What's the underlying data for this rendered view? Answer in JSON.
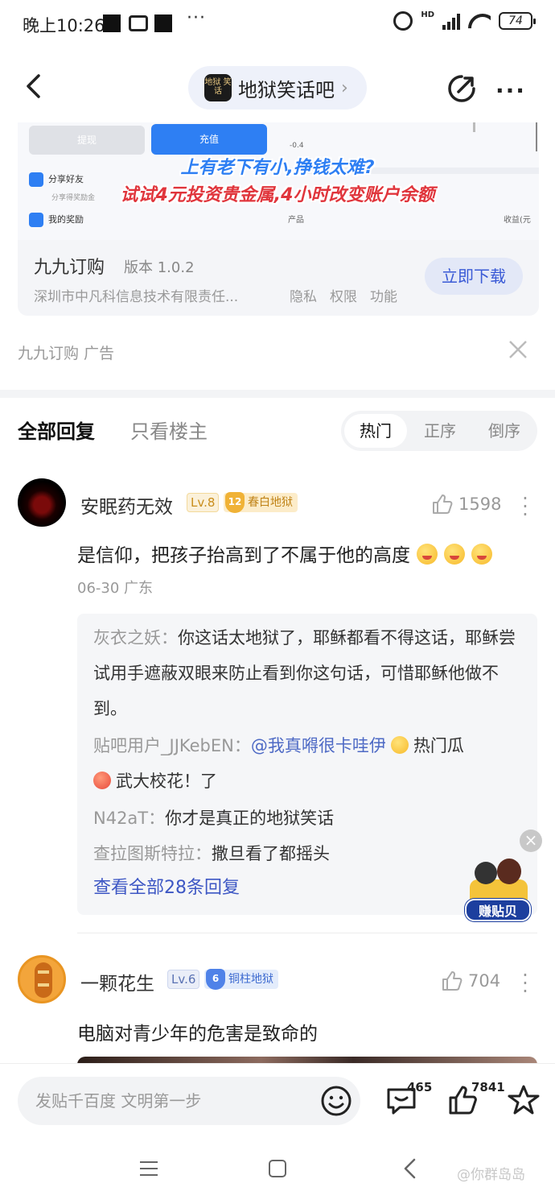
{
  "status_bar": {
    "time": "晚上10:26",
    "dots": "···",
    "battery": "74",
    "hd": "HD"
  },
  "nav": {
    "forum_logo_text": "地狱 笑话",
    "forum_name": "地狱笑话吧",
    "forum_arrow": "›"
  },
  "ad": {
    "visual": {
      "withdraw": "提现",
      "recharge": "充值",
      "share_friends": "分享好友",
      "share_sub": "分享得奖励金",
      "my_rewards": "我的奖励",
      "neg_value": "-0.4",
      "product": "产品",
      "income": "收益(元",
      "caption_line1": "上有老下有小,挣钱太难?",
      "caption_line2": "试试4元投资贵金属,4小时改变账户余额"
    },
    "app_name": "九九订购",
    "version": "版本 1.0.2",
    "company": "深圳市中凡科信息技术有限责任...",
    "links": [
      "隐私",
      "权限",
      "功能"
    ],
    "download_label": "立即下载",
    "source": "九九订购  广告"
  },
  "tabs": {
    "all_replies": "全部回复",
    "op_only": "只看楼主",
    "sort": [
      "热门",
      "正序",
      "倒序"
    ]
  },
  "comments": [
    {
      "username": "安眠药无效",
      "level": "Lv.8",
      "badge_num": "12",
      "badge_title": "春白地狱",
      "likes": "1598",
      "text": "是信仰，把孩子抬高到了不属于他的高度",
      "meta": "06-30  广东",
      "replies": [
        {
          "name": "灰衣之妖：",
          "text": "你这话太地狱了，耶稣都看不得这话，耶稣尝试用手遮蔽双眼来防止看到你这句话，可惜耶稣他做不到。"
        },
        {
          "name": "贴吧用户_JJKebEN：",
          "at": "@我真嘚很卡哇伊",
          "text1": "热门瓜",
          "text2": "武大校花！了"
        },
        {
          "name": "N42aT：",
          "text": "你才是真正的地狱笑话"
        },
        {
          "name": "查拉图斯特拉：",
          "text": "撒旦看了都摇头"
        }
      ],
      "view_all": "查看全部28条回复"
    },
    {
      "username": "一颗花生",
      "level": "Lv.6",
      "badge_num": "6",
      "badge_title": "铜柱地狱",
      "likes": "704",
      "text": "电脑对青少年的危害是致命的"
    }
  ],
  "float": {
    "label": "赚贴贝",
    "close": "×"
  },
  "bottom": {
    "placeholder": "发贴千百度 文明第一步",
    "comment_count": "465",
    "like_count": "7841"
  },
  "watermark": "@你群岛岛"
}
